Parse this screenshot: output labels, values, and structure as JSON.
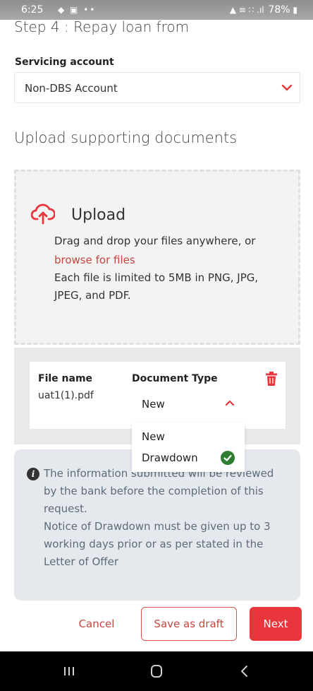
{
  "status_bar": {
    "time": "6:25",
    "left_icons": "◆ ▣ ••",
    "signal_text": "▲ ≡ ∷ .ıl",
    "battery": "78%"
  },
  "step_title": "Step 4 : Repay loan from",
  "servicing": {
    "label": "Servicing account",
    "value": "Non-DBS Account",
    "chevron_icon": "chevron-down-icon"
  },
  "upload_section_title": "Upload supporting documents",
  "upload": {
    "heading": "Upload",
    "icon": "cloud-upload-icon",
    "drag_text": "Drag and drop your files anywhere, or",
    "browse_link": "browse for files",
    "limit_line1": "Each file is limited to 5MB in PNG, JPG,",
    "limit_line2": "JPEG, and PDF."
  },
  "file_table": {
    "col_filename": "File name",
    "col_doctype": "Document Type",
    "filename": "uat1(1).pdf",
    "doctype_value": "New",
    "delete_icon": "trash-icon"
  },
  "doctype_dropdown": {
    "options": [
      "New",
      "Drawdown"
    ],
    "checked_icon": "check-circle-icon"
  },
  "info": {
    "icon": "info-icon",
    "lines": [
      "The information submitted will be reviewed",
      "by the bank before the completion of this",
      "request.",
      "Notice of Drawdown must be given up to 3",
      "working days prior or as per stated in the",
      "Letter of Offer"
    ]
  },
  "actions": {
    "cancel": "Cancel",
    "save_draft": "Save as draft",
    "next": "Next"
  },
  "nav_bar": {
    "icons": [
      "recent-apps-icon",
      "home-icon",
      "back-icon"
    ]
  },
  "colors": {
    "accent_red": "#e8363c",
    "link_red": "#c5463f",
    "check_green": "#2e7d32",
    "info_bg": "#e5e9ee"
  }
}
